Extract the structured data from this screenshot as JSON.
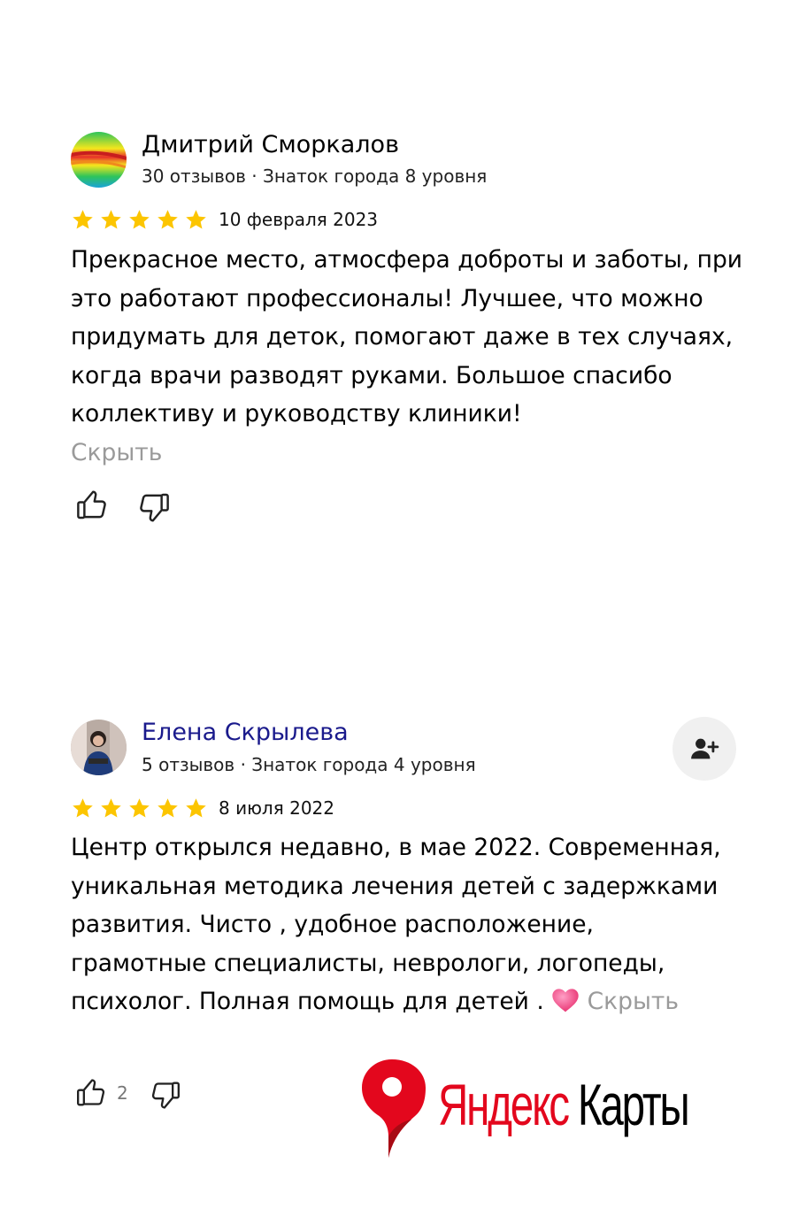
{
  "reviews": [
    {
      "author": "Дмитрий Сморкалов",
      "meta": "30 отзывов · Знаток города 8 уровня",
      "rating": 5,
      "date": "10 февраля 2023",
      "text": "Прекрасное место, атмосфера доброты и заботы, при это работают профессионалы! Лучшее, что можно придумать для деток, помогают даже в тех случаях, когда врачи разводят руками. Большое спасибо коллективу и руководству клиники!",
      "hide_label": "Скрыть",
      "likes": ""
    },
    {
      "author": "Елена Скрылева",
      "meta": "5 отзывов · Знаток города 4 уровня",
      "rating": 5,
      "date": "8 июля 2022",
      "text": "Центр открылся недавно, в мае 2022. Современная, уникальная методика лечения детей с задержками развития. Чисто , удобное расположение, грамотные специалисты, неврологи, логопеды, психолог. Полная помощь для детей .",
      "emoji": "heart-emoji",
      "hide_label": "Скрыть",
      "likes": "2"
    }
  ],
  "brand": {
    "part1": "Яндекс",
    "part2": "Карты"
  },
  "colors": {
    "star": "#fcc500",
    "author_link": "#1a1a8c",
    "brand_red": "#e3071d",
    "muted": "#9a9a9a"
  },
  "icons": [
    "thumb-up-icon",
    "thumb-down-icon",
    "add-friend-icon",
    "map-pin-icon",
    "star-icon"
  ]
}
